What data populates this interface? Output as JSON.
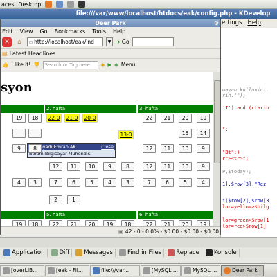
{
  "panel": {
    "items": [
      "aces",
      "Desktop"
    ]
  },
  "kdevelop": {
    "title": "file:///var/www/localhost/htdocs/eak/config.php - KDevelop",
    "menu": [
      "ettings",
      "Help"
    ],
    "code_lines": [
      "mayan kullanici.",
      "rih.\"\");",
      "'I') and (rtarih",
      "\":",
      "\"Bt\";}",
      "r\"><tr>\";",
      "P,$today);",
      "1],$row[3],\"Rez",
      "i($row[2],$row[3",
      "lor=yellow>$bilg",
      "lor=green>$row[1",
      "lor=red>$row[1]"
    ],
    "tools": [
      {
        "label": "Application",
        "icon": "application-icon"
      },
      {
        "label": "Diff",
        "icon": "diff-icon"
      },
      {
        "label": "Messages",
        "icon": "messages-icon"
      },
      {
        "label": "Find in Files",
        "icon": "find-icon"
      },
      {
        "label": "Replace",
        "icon": "replace-icon"
      },
      {
        "label": "Konsole",
        "icon": "konsole-icon"
      }
    ]
  },
  "taskbar": {
    "tasks": [
      "[overLIB...",
      "[eak - Fil...",
      "file:///var...",
      "[MySQL ...",
      "MySQL ...",
      "Deer Park"
    ]
  },
  "browser": {
    "title": "Deer Park",
    "menu": [
      "Edit",
      "View",
      "Go",
      "Bookmarks",
      "Tools",
      "Help"
    ],
    "url": "http://localhost/eak/ind",
    "go_label": "Go",
    "bookmark": "Latest Headlines",
    "like_label": "I like it!",
    "tag_placeholder": "Search or Tag here",
    "menu_label": "Menu",
    "heading": "syon",
    "status": "42 - 0 - 0.0% - $0.00 - $0.00 - $0.00",
    "weeks": [
      "2. hafta",
      "3. hafta",
      "5. hafta",
      "6. hafta"
    ],
    "tooltip": {
      "head": "Adi soyadi:Emrah AK",
      "close": "Close",
      "body": "Bolum:Bilgisayar Muhendis."
    },
    "rows": {
      "r1": [
        "19",
        "18"
      ],
      "r1_mid": [
        "22-0",
        "21-0",
        "20-0"
      ],
      "r1_right": [
        "22",
        "21",
        "20",
        "19"
      ],
      "r2_right": [
        "15",
        "14"
      ],
      "r2_mid": [
        "13-0"
      ],
      "r3": [
        "9",
        "8"
      ],
      "r3_mid": [
        "12",
        "11",
        "10",
        "9",
        "8"
      ],
      "r3_right": [
        "12",
        "11",
        "10",
        "9",
        "8"
      ],
      "r4": [
        "4",
        "3"
      ],
      "r4_mid": [
        "7",
        "6",
        "5",
        "4",
        "3"
      ],
      "r4_right": [
        "7",
        "6",
        "5",
        "4",
        "3"
      ],
      "r5_mid": [
        "2",
        "1"
      ],
      "r6": [
        "19",
        "18"
      ],
      "r6_mid": [
        "22",
        "21",
        "20",
        "19",
        "18"
      ],
      "r6_right": [
        "22",
        "21",
        "20",
        "19",
        "18"
      ]
    }
  }
}
